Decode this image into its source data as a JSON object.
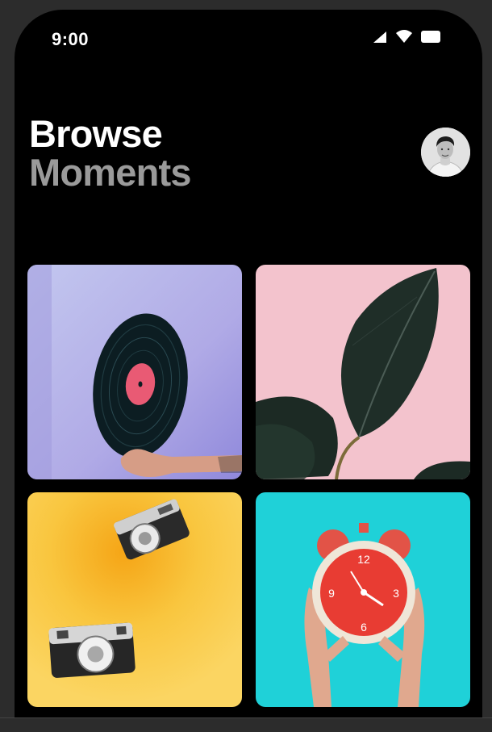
{
  "status_bar": {
    "time": "9:00",
    "icons": [
      "signal-icon",
      "wifi-icon",
      "battery-icon"
    ]
  },
  "header": {
    "title_line1": "Browse",
    "title_line2": "Moments",
    "title_color": "#ffffff",
    "subtitle_color": "#9a9a9a"
  },
  "profile": {
    "avatar_icon": "avatar"
  },
  "moments": [
    {
      "subject": "vinyl-record",
      "background": "#b9b6e8"
    },
    {
      "subject": "rubber-plant-leaf",
      "background": "#f3c3cd"
    },
    {
      "subject": "cameras",
      "background": "#f9cc47"
    },
    {
      "subject": "alarm-clock",
      "background": "#1fd1d8"
    }
  ]
}
